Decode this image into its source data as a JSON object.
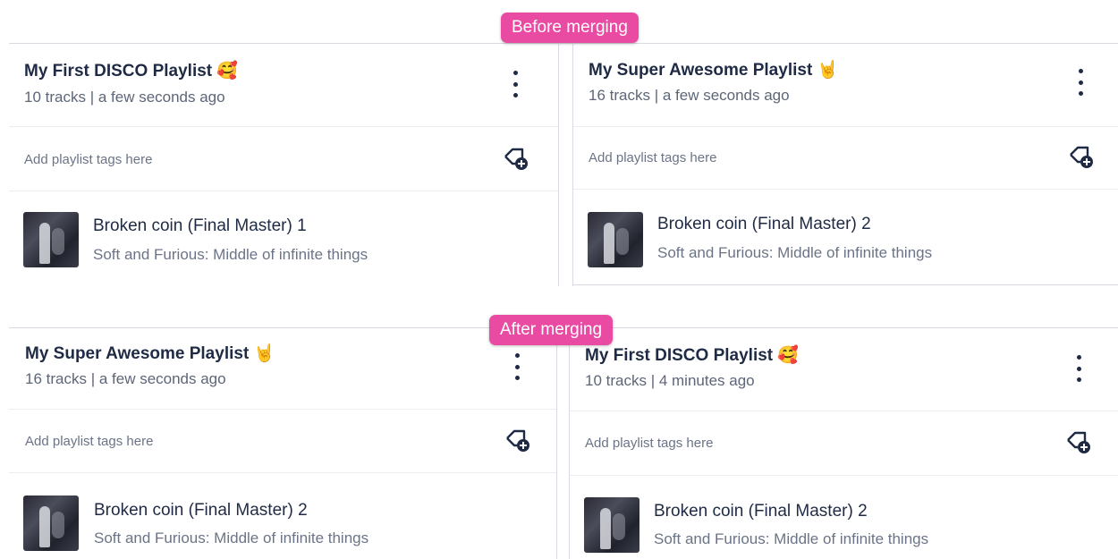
{
  "before": {
    "label": "Before merging",
    "left": {
      "title": "My First DISCO Playlist",
      "emoji": "🥰",
      "meta": "10 tracks | a few seconds ago",
      "tags_placeholder": "Add playlist tags here",
      "track": {
        "title": "Broken coin (Final Master) 1",
        "subtitle": "Soft and Furious: Middle of infinite things"
      }
    },
    "right": {
      "title": "My Super Awesome Playlist",
      "emoji": "🤘",
      "meta": "16 tracks | a few seconds ago",
      "tags_placeholder": "Add playlist tags here",
      "track": {
        "title": "Broken coin (Final Master) 2",
        "subtitle": "Soft and Furious: Middle of infinite things"
      }
    }
  },
  "after": {
    "label": "After merging",
    "left": {
      "title": "My Super Awesome Playlist",
      "emoji": "🤘",
      "meta": "16 tracks | a few seconds ago",
      "tags_placeholder": "Add playlist tags here",
      "track": {
        "title": "Broken coin (Final Master) 2",
        "subtitle": "Soft and Furious: Middle of infinite things"
      }
    },
    "right": {
      "title": "My First DISCO Playlist",
      "emoji": "🥰",
      "meta": "10 tracks | 4 minutes ago",
      "tags_placeholder": "Add playlist tags here",
      "track": {
        "title": "Broken coin (Final Master) 2",
        "subtitle": "Soft and Furious: Middle of infinite things"
      }
    }
  },
  "icons": {
    "menu": "kebab-menu-icon",
    "tag": "add-tag-icon",
    "artwork": "album-art"
  },
  "colors": {
    "accent_pill": "#e94ba3",
    "text_primary": "#1f2a44",
    "text_secondary": "#5d6678"
  }
}
